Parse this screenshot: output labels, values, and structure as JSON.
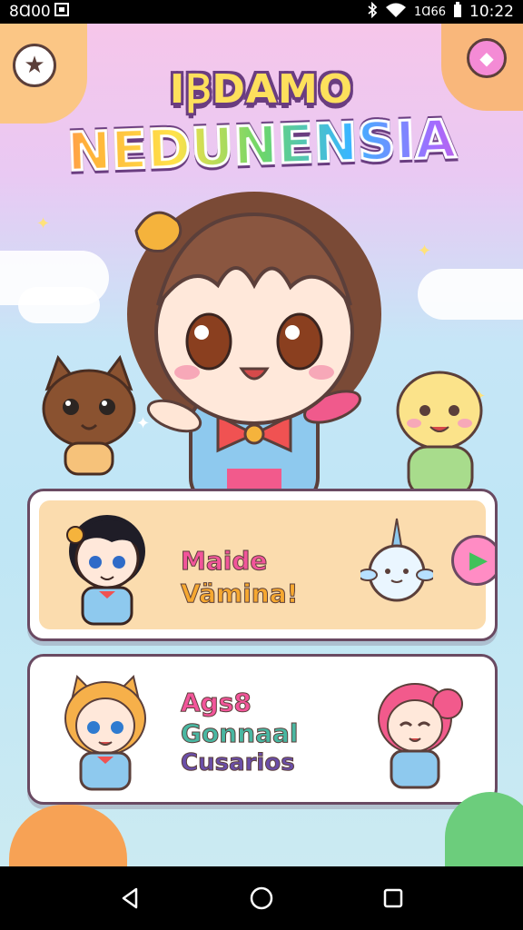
{
  "status_bar": {
    "left_text": "8Ɑ00",
    "right_text": "1Ɑ66",
    "time": "10:22",
    "icons": [
      "notification-icon",
      "bluetooth-icon",
      "wifi-icon",
      "battery-icon"
    ]
  },
  "header": {
    "title_top": "IꞴDAMO",
    "title_main": "NEDUNENSIA"
  },
  "menu": [
    {
      "lines": [
        "Maide",
        "Vämina!"
      ],
      "action_icon": "play-icon"
    },
    {
      "lines": [
        "Ags8",
        "Gonnaal",
        "Cusarios"
      ]
    }
  ],
  "nav": {
    "icons": [
      "back-icon",
      "home-icon",
      "recents-icon"
    ]
  },
  "colors": {
    "pink": "#f2559a",
    "orange": "#f6a830",
    "teal": "#49b7a2",
    "purple": "#6a4ea8",
    "outline": "#6a4a62"
  }
}
